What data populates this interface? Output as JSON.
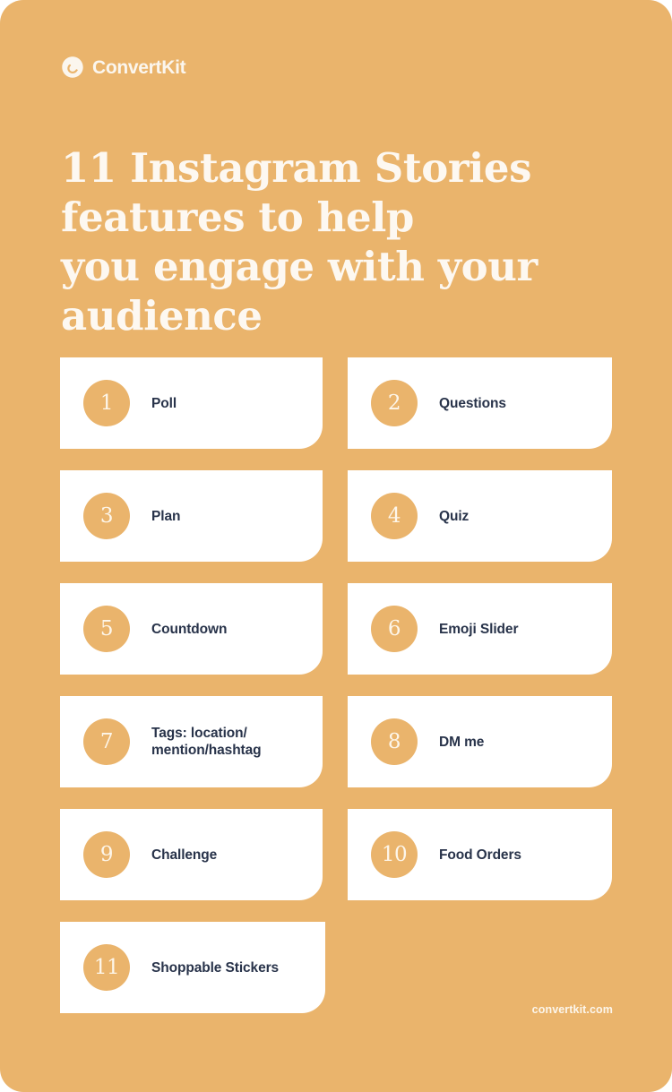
{
  "brand": {
    "name": "ConvertKit",
    "logo_icon": "convertkit-swirl-icon"
  },
  "headline": {
    "line1": "11 Instagram Stories",
    "line2": "features to help",
    "line3": "you engage with your",
    "line4": "audience"
  },
  "colors": {
    "background": "#eab46c",
    "card_background": "#ffffff",
    "badge": "#eab46c",
    "headline_text": "#fdf8f1",
    "label_text": "#28334a",
    "badge_number_text": "#fdf6ea"
  },
  "features": [
    {
      "number": "1",
      "label_line1": "Poll",
      "label_line2": ""
    },
    {
      "number": "2",
      "label_line1": "Questions",
      "label_line2": ""
    },
    {
      "number": "3",
      "label_line1": "Plan",
      "label_line2": ""
    },
    {
      "number": "4",
      "label_line1": "Quiz",
      "label_line2": ""
    },
    {
      "number": "5",
      "label_line1": "Countdown",
      "label_line2": ""
    },
    {
      "number": "6",
      "label_line1": "Emoji Slider",
      "label_line2": ""
    },
    {
      "number": "7",
      "label_line1": "Tags: location/",
      "label_line2": "mention/hashtag"
    },
    {
      "number": "8",
      "label_line1": "DM me",
      "label_line2": ""
    },
    {
      "number": "9",
      "label_line1": "Challenge",
      "label_line2": ""
    },
    {
      "number": "10",
      "label_line1": "Food Orders",
      "label_line2": ""
    },
    {
      "number": "11",
      "label_line1": "Shoppable Stickers",
      "label_line2": ""
    }
  ],
  "footer": {
    "url": "convertkit.com"
  }
}
